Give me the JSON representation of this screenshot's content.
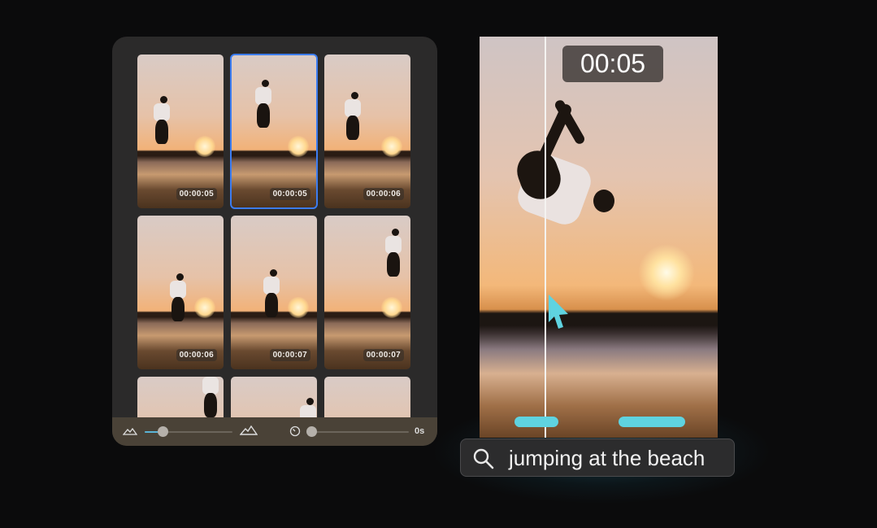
{
  "gallery": {
    "thumbnails": [
      {
        "timestamp": "00:00:05",
        "selected": false
      },
      {
        "timestamp": "00:00:05",
        "selected": true
      },
      {
        "timestamp": "00:00:06",
        "selected": false
      },
      {
        "timestamp": "00:00:06",
        "selected": false
      },
      {
        "timestamp": "00:00:07",
        "selected": false
      },
      {
        "timestamp": "00:00:07",
        "selected": false
      },
      {
        "timestamp": "",
        "selected": false
      },
      {
        "timestamp": "",
        "selected": false
      },
      {
        "timestamp": "",
        "selected": false
      }
    ],
    "controls": {
      "thumbnail_size_fraction": 0.2,
      "duration_fraction": 0.0,
      "duration_label": "0s",
      "slider_accent": "#5ab4d6",
      "icons": [
        "mountains-small-icon",
        "mountains-large-icon",
        "timer-icon"
      ]
    },
    "selection_color": "#3c7cf0"
  },
  "player": {
    "timestamp": "00:05",
    "match_color": "#5fd3e0",
    "search": {
      "icon": "search-icon",
      "query": "jumping at the beach"
    }
  }
}
